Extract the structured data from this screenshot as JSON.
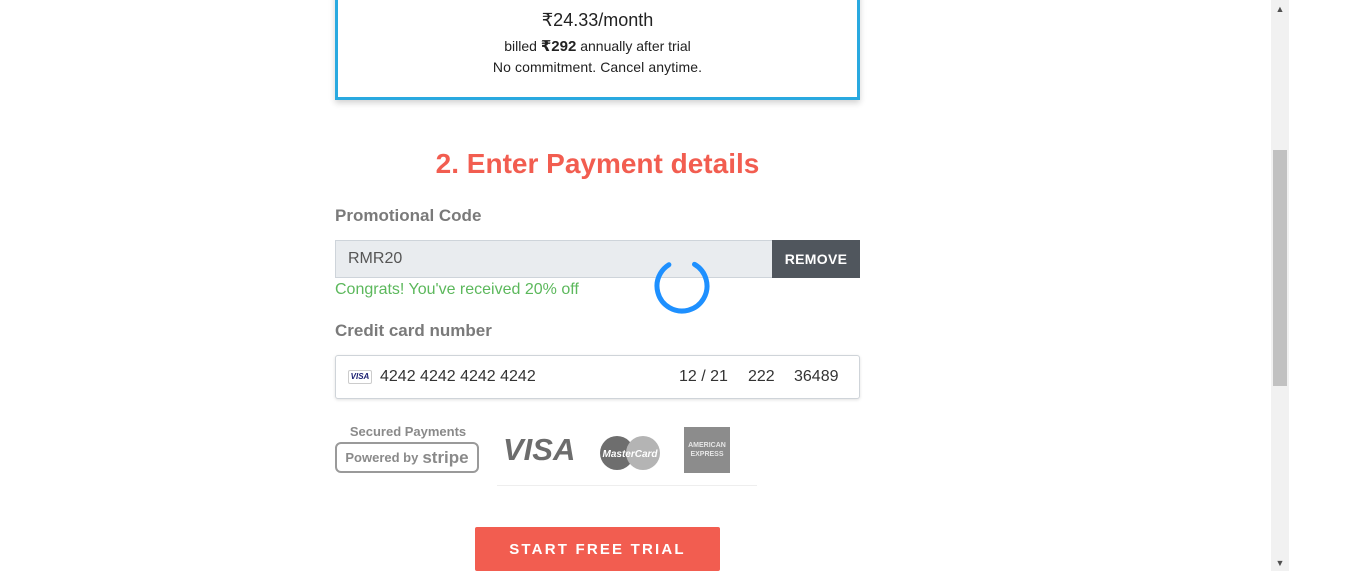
{
  "plan": {
    "price": "₹24.33/month",
    "billed_prefix": "billed ",
    "billed_amount": "₹292",
    "billed_suffix": " annually after trial",
    "commitment": "No commitment. Cancel anytime."
  },
  "payment": {
    "title": "2. Enter Payment details",
    "promo_label": "Promotional Code",
    "promo_value": "RMR20",
    "remove_label": "REMOVE",
    "promo_message": "Congrats! You've received 20% off",
    "card_label": "Credit card number",
    "card_brand": "VISA",
    "card_number": "4242 4242 4242 4242",
    "card_expiry": "12 / 21",
    "card_cvc": "222",
    "card_zip": "36489"
  },
  "badges": {
    "secured": "Secured Payments",
    "powered_by": "Powered by",
    "stripe": "stripe",
    "visa": "VISA",
    "mastercard": "MasterCard",
    "amex_line1": "AMERICAN",
    "amex_line2": "EXPRESS"
  },
  "cta": {
    "label": "START FREE TRIAL"
  },
  "colors": {
    "accent": "#f25d50",
    "plan_border": "#29a9e0",
    "success": "#5cb85c",
    "spinner": "#1e90ff"
  }
}
